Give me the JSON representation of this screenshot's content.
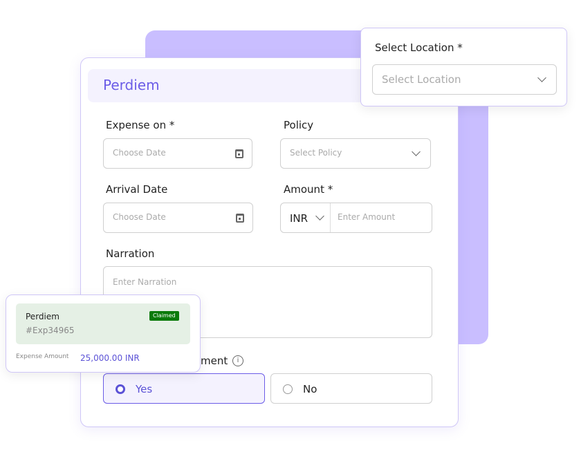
{
  "form": {
    "title": "Perdiem",
    "expense_on": {
      "label": "Expense on *",
      "placeholder": "Choose Date"
    },
    "policy": {
      "label": "Policy",
      "placeholder": "Select Policy"
    },
    "arrival_date": {
      "label": "Arrival Date",
      "placeholder": "Choose Date"
    },
    "amount": {
      "label": "Amount *",
      "currency": "INR",
      "placeholder": "Enter Amount"
    },
    "narration": {
      "label": "Narration",
      "placeholder": "Enter Narration"
    },
    "reimbursement": {
      "label_visible": "ment",
      "options": [
        {
          "label": "Yes",
          "selected": true
        },
        {
          "label": "No",
          "selected": false
        }
      ]
    }
  },
  "location_popup": {
    "label": "Select Location *",
    "placeholder": "Select Location"
  },
  "expense_card": {
    "title": "Perdiem",
    "id": "#Exp34965",
    "status": "Claimed",
    "amount_label": "Expense Amount",
    "amount": "25,000.00 INR"
  },
  "colors": {
    "accent": "#6b5ce7",
    "claimed": "#0a7a0a",
    "backdrop": "#c9beff"
  }
}
